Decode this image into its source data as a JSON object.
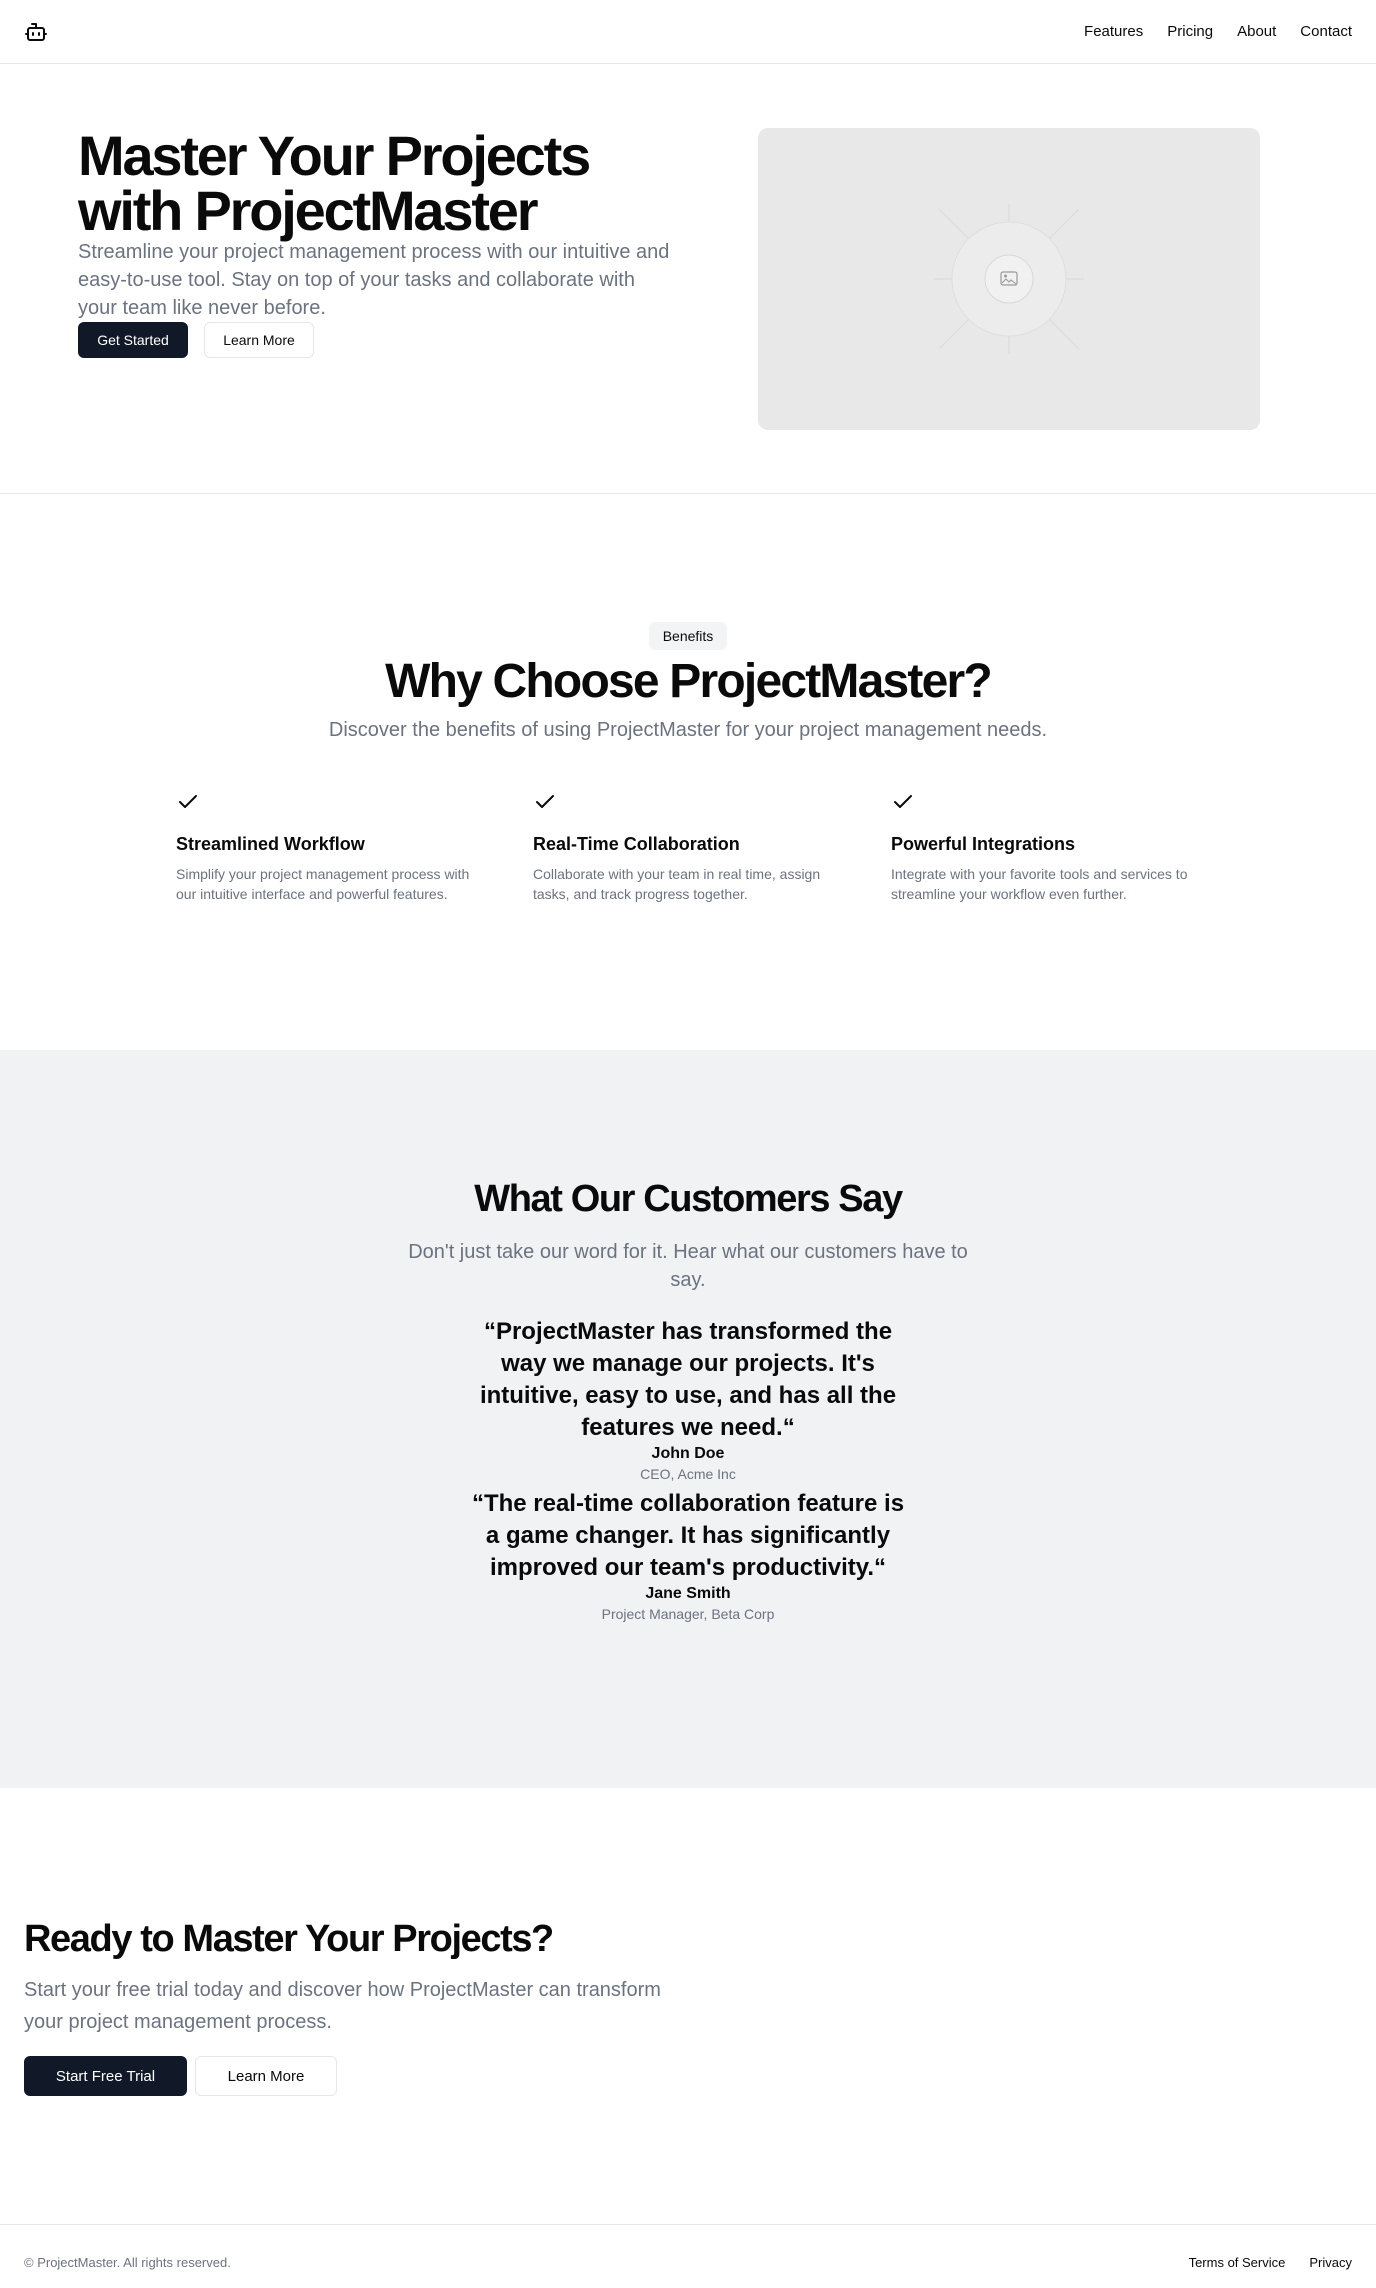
{
  "header": {
    "logo_icon": "bot-icon",
    "nav": [
      "Features",
      "Pricing",
      "About",
      "Contact"
    ]
  },
  "hero": {
    "title": "Master Your Projects with ProjectMaster",
    "subtitle": "Streamline your project management process with our intuitive and easy-to-use tool. Stay on top of your tasks and collaborate with your team like never before.",
    "primary_button": "Get Started",
    "secondary_button": "Learn More",
    "image_icon": "image-placeholder-icon"
  },
  "benefits": {
    "badge": "Benefits",
    "title": "Why Choose ProjectMaster?",
    "subtitle": "Discover the benefits of using ProjectMaster for your project management needs.",
    "items": [
      {
        "icon": "check-icon",
        "title": "Streamlined Workflow",
        "description": "Simplify your project management process with our intuitive interface and powerful features."
      },
      {
        "icon": "check-icon",
        "title": "Real-Time Collaboration",
        "description": "Collaborate with your team in real time, assign tasks, and track progress together."
      },
      {
        "icon": "check-icon",
        "title": "Powerful Integrations",
        "description": "Integrate with your favorite tools and services to streamline your workflow even further."
      }
    ]
  },
  "testimonials": {
    "title": "What Our Customers Say",
    "subtitle": "Don't just take our word for it. Hear what our customers have to say.",
    "items": [
      {
        "quote": "“ProjectMaster has transformed the way we manage our projects. It's intuitive, easy to use, and has all the features we need.“",
        "name": "John Doe",
        "role": "CEO, Acme Inc"
      },
      {
        "quote": "“The real-time collaboration feature is a game changer. It has significantly improved our team's productivity.“",
        "name": "Jane Smith",
        "role": "Project Manager, Beta Corp"
      }
    ]
  },
  "cta": {
    "title": "Ready to Master Your Projects?",
    "subtitle": "Start your free trial today and discover how ProjectMaster can transform your project management process.",
    "primary_button": "Start Free Trial",
    "secondary_button": "Learn More"
  },
  "footer": {
    "copyright": "© ProjectMaster. All rights reserved.",
    "links": [
      "Terms of Service",
      "Privacy"
    ]
  },
  "colors": {
    "primary": "#111827",
    "muted_text": "#6b7280",
    "section_bg": "#f1f2f4",
    "placeholder_bg": "#e8e8e8"
  }
}
